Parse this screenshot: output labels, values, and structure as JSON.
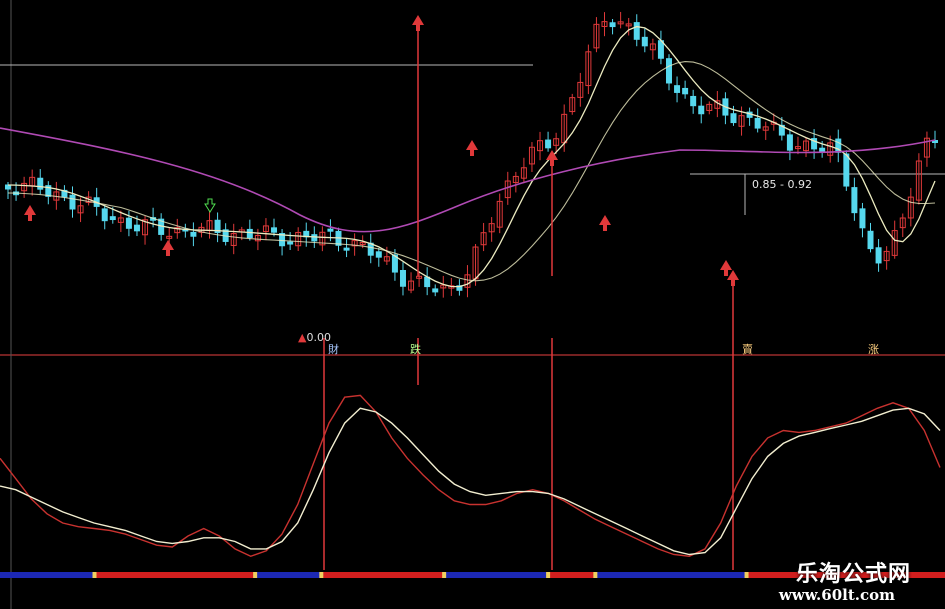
{
  "chart_data": {
    "type": "line",
    "colors": {
      "background": "#000000",
      "up_candle": "#e0393a",
      "down_candle": "#56d8ee",
      "ma_short": "#ecebc0",
      "ma_long": "#b04ab4",
      "signal_line": "#e0393a",
      "osc_fast": "#c8322f",
      "osc_slow": "#f2eed0",
      "bar_red": "#d21e1e",
      "bar_blue": "#1c28b4",
      "bar_tick": "#f0d060"
    },
    "panels": [
      {
        "name": "price",
        "annotation_value": "0.00",
        "range_label": "0.85 - 0.92",
        "candles_pattern": "down-up-down-up",
        "signal_markers": [
          "財",
          "跌",
          "賣",
          "涨"
        ]
      },
      {
        "name": "oscillator",
        "x": [
          0,
          1,
          2,
          3,
          4,
          5,
          6,
          7,
          8,
          9,
          10,
          11,
          12,
          13,
          14,
          15,
          16,
          17,
          18,
          19,
          20,
          21,
          22,
          23,
          24,
          25,
          26,
          27,
          28,
          29,
          30,
          31,
          32,
          33,
          34,
          35,
          36,
          37,
          38,
          39,
          40,
          41,
          42,
          43,
          44,
          45,
          46,
          47,
          48,
          49,
          50,
          51,
          52,
          53,
          54,
          55,
          56,
          57,
          58,
          59,
          60
        ],
        "series": [
          {
            "values": [
              0.55,
              0.44,
              0.33,
              0.25,
              0.2,
              0.18,
              0.17,
              0.16,
              0.14,
              0.11,
              0.08,
              0.07,
              0.13,
              0.17,
              0.13,
              0.06,
              0.02,
              0.05,
              0.14,
              0.3,
              0.52,
              0.74,
              0.88,
              0.89,
              0.8,
              0.66,
              0.55,
              0.46,
              0.38,
              0.32,
              0.3,
              0.3,
              0.32,
              0.36,
              0.38,
              0.36,
              0.32,
              0.27,
              0.22,
              0.18,
              0.14,
              0.1,
              0.06,
              0.03,
              0.02,
              0.06,
              0.2,
              0.4,
              0.56,
              0.66,
              0.7,
              0.69,
              0.7,
              0.72,
              0.74,
              0.78,
              0.82,
              0.85,
              0.82,
              0.7,
              0.5
            ]
          },
          {
            "values": [
              0.4,
              0.38,
              0.34,
              0.3,
              0.26,
              0.23,
              0.2,
              0.18,
              0.16,
              0.13,
              0.1,
              0.09,
              0.1,
              0.12,
              0.12,
              0.1,
              0.06,
              0.06,
              0.1,
              0.2,
              0.38,
              0.58,
              0.74,
              0.82,
              0.8,
              0.74,
              0.66,
              0.57,
              0.48,
              0.41,
              0.37,
              0.35,
              0.36,
              0.37,
              0.37,
              0.36,
              0.33,
              0.29,
              0.25,
              0.21,
              0.17,
              0.13,
              0.09,
              0.05,
              0.03,
              0.04,
              0.12,
              0.28,
              0.44,
              0.56,
              0.63,
              0.67,
              0.69,
              0.71,
              0.73,
              0.75,
              0.78,
              0.81,
              0.82,
              0.79,
              0.7
            ]
          }
        ]
      }
    ],
    "bottom_bar": [
      {
        "color": "blue",
        "span": [
          0.0,
          0.1
        ]
      },
      {
        "color": "red",
        "span": [
          0.1,
          0.27
        ]
      },
      {
        "color": "blue",
        "span": [
          0.27,
          0.34
        ]
      },
      {
        "color": "red",
        "span": [
          0.34,
          0.47
        ]
      },
      {
        "color": "blue",
        "span": [
          0.47,
          0.58
        ]
      },
      {
        "color": "red",
        "span": [
          0.58,
          0.63
        ]
      },
      {
        "color": "blue",
        "span": [
          0.63,
          0.79
        ]
      },
      {
        "color": "red",
        "span": [
          0.79,
          1.0
        ]
      }
    ]
  },
  "watermark": {
    "name": "乐淘公式网",
    "url": "www.60lt.com"
  }
}
